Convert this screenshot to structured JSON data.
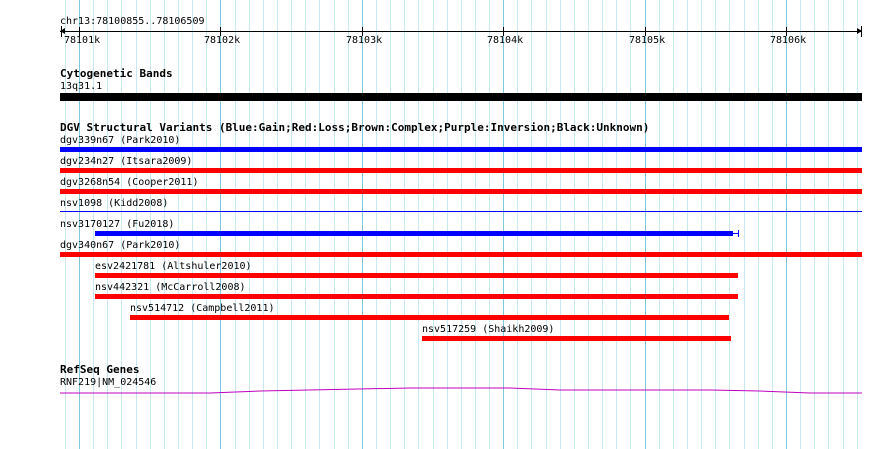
{
  "ruler": {
    "region": "chr13:78100855..78106509",
    "ticks": [
      "78101k",
      "78102k",
      "78103k",
      "78104k",
      "78105k",
      "78106k"
    ]
  },
  "tracks": {
    "cytoband": {
      "title": "Cytogenetic Bands",
      "band": "13q31.1",
      "color": "#000000"
    },
    "dgv": {
      "title": "DGV Structural Variants (Blue:Gain;Red:Loss;Brown:Complex;Purple:Inversion;Black:Unknown)",
      "features": [
        {
          "label": "dgv339n67 (Park2010)",
          "color": "#0000ff"
        },
        {
          "label": "dgv234n27 (Itsara2009)",
          "color": "#ff0000"
        },
        {
          "label": "dgv3268n54 (Cooper2011)",
          "color": "#ff0000"
        },
        {
          "label": "nsv1098 (Kidd2008)",
          "color": "#0000ff"
        },
        {
          "label": "nsv3170127 (Fu2018)",
          "color": "#0000ff"
        },
        {
          "label": "dgv340n67 (Park2010)",
          "color": "#ff0000"
        },
        {
          "label": "esv2421781 (Altshuler2010)",
          "color": "#ff0000"
        },
        {
          "label": "nsv442321 (McCarroll2008)",
          "color": "#ff0000"
        },
        {
          "label": "nsv514712 (Campbell2011)",
          "color": "#ff0000"
        },
        {
          "label": "nsv517259 (Shaikh2009)",
          "color": "#ff0000"
        }
      ]
    },
    "refseq": {
      "title": "RefSeq Genes",
      "gene": "RNF219|NM_024546",
      "color": "#c000c0"
    }
  }
}
